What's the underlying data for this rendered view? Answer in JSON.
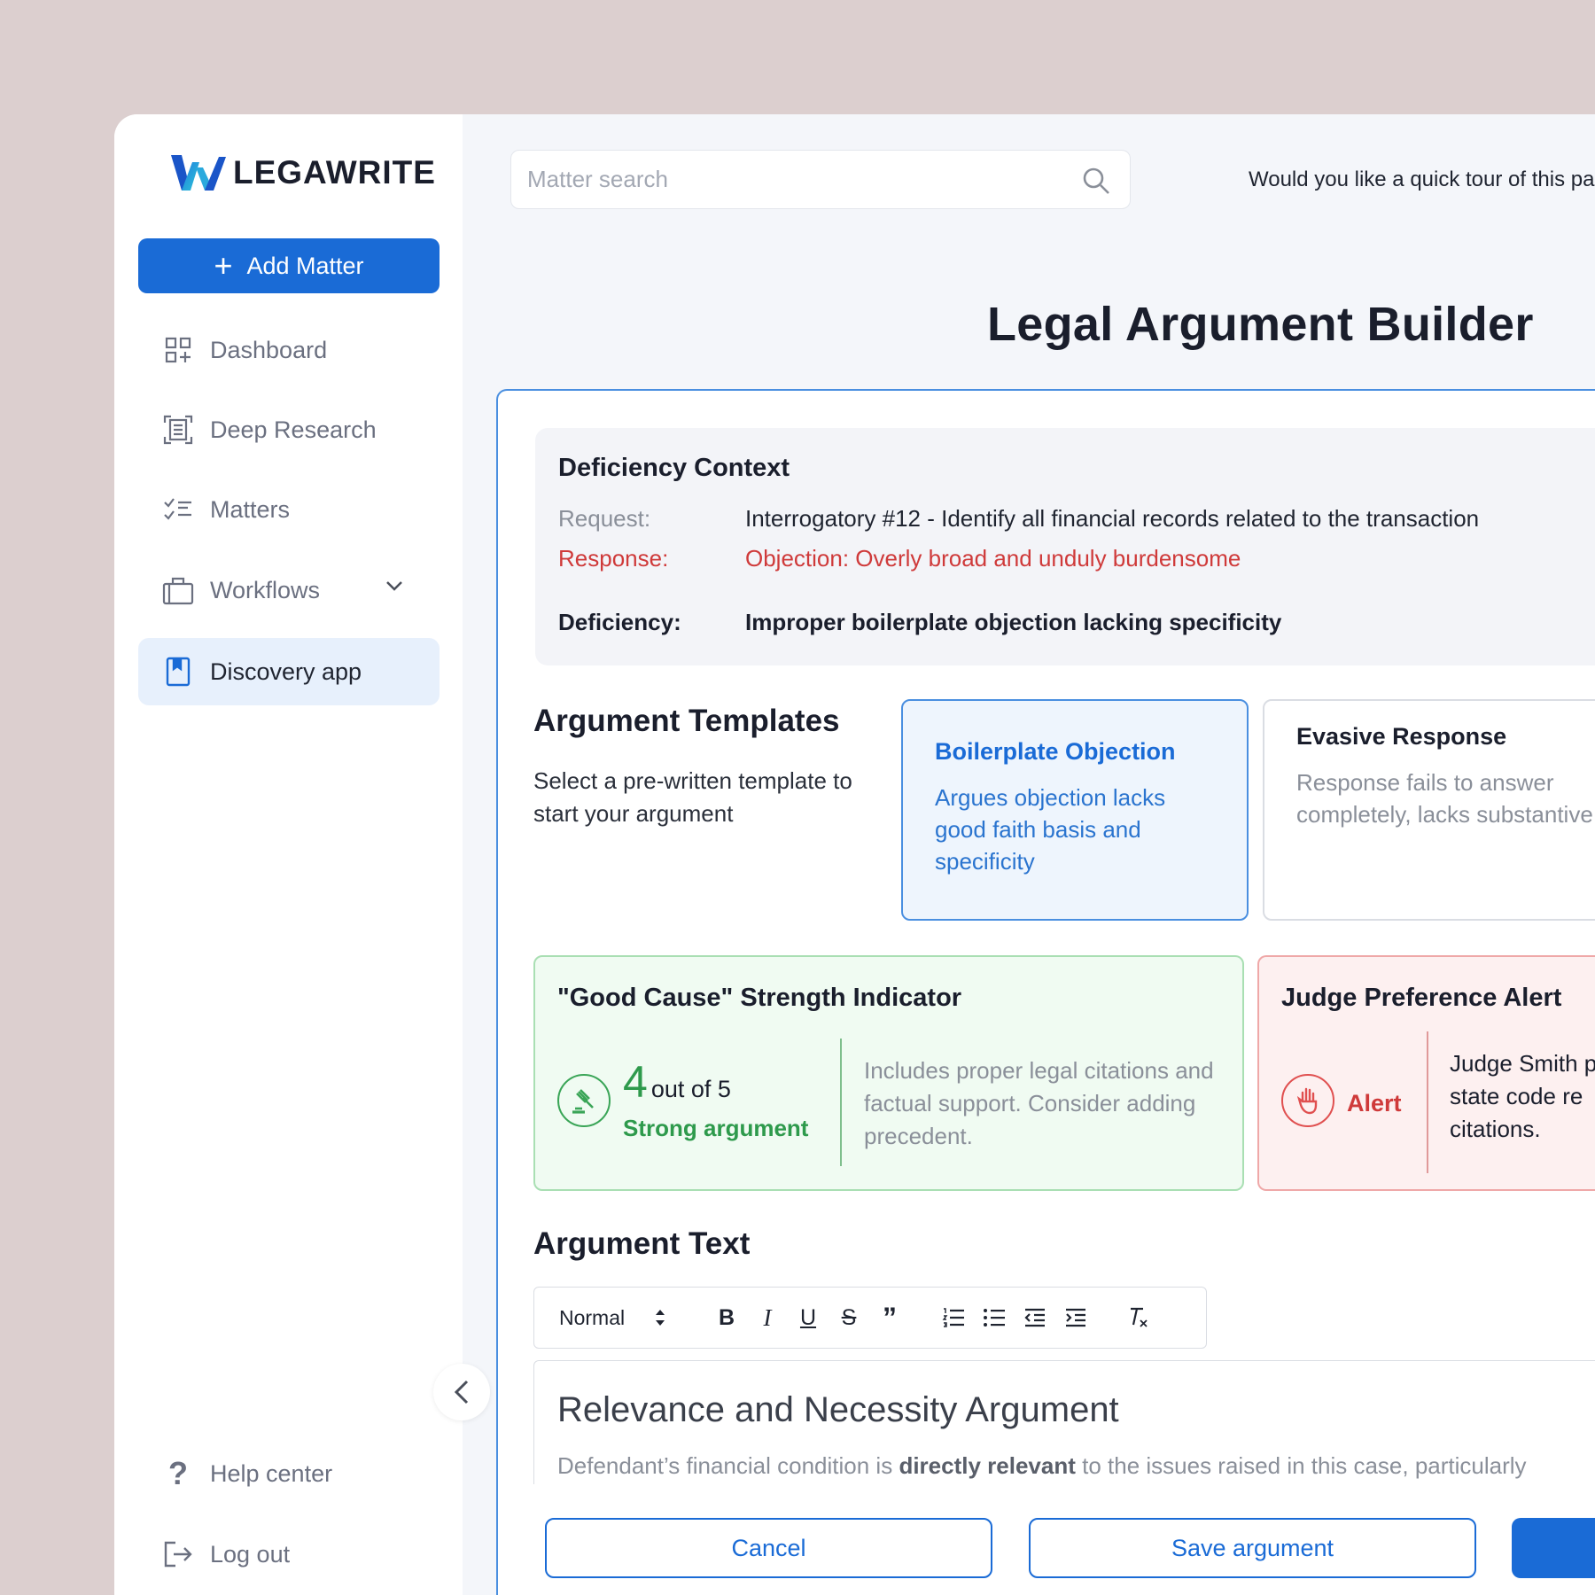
{
  "brand": {
    "name": "LEGAWRITE"
  },
  "sidebar": {
    "add_button": "Add Matter",
    "items": [
      {
        "label": "Dashboard",
        "icon": "dashboard-icon"
      },
      {
        "label": "Deep Research",
        "icon": "document-scan-icon"
      },
      {
        "label": "Matters",
        "icon": "checklist-icon"
      },
      {
        "label": "Workflows",
        "icon": "briefcase-icon",
        "expandable": true
      },
      {
        "label": "Discovery app",
        "icon": "bookmark-book-icon",
        "active": true
      }
    ],
    "footer": [
      {
        "label": "Help center",
        "icon": "question-icon"
      },
      {
        "label": "Log out",
        "icon": "logout-icon"
      }
    ]
  },
  "header": {
    "search_placeholder": "Matter search",
    "tour_prompt": "Would you like a quick tour of this pa"
  },
  "page": {
    "title": "Legal Argument Builder"
  },
  "context": {
    "title": "Deficiency Context",
    "request_label": "Request:",
    "request_value": "Interrogatory #12 - Identify all financial records related to the transaction",
    "response_label": "Response:",
    "response_value": "Objection: Overly broad and unduly burdensome",
    "deficiency_label": "Deficiency:",
    "deficiency_value": "Improper boilerplate objection lacking specificity"
  },
  "templates": {
    "title": "Argument Templates",
    "subtitle": "Select a pre-written template to start your argument",
    "cards": [
      {
        "title": "Boilerplate Objection",
        "desc": "Argues objection lacks good faith basis and specificity",
        "selected": true
      },
      {
        "title": "Evasive Response",
        "desc": "Response fails to answer completely, lacks substantive",
        "selected": false
      }
    ]
  },
  "strength": {
    "title": "\"Good Cause\" Strength Indicator",
    "score": "4",
    "score_suffix": "out of 5",
    "label": "Strong argument",
    "description": "Includes proper legal citations and factual support. Consider adding precedent."
  },
  "judge": {
    "title": "Judge Preference Alert",
    "badge": "Alert",
    "line1": "Judge Smith p",
    "line2": "state code re",
    "line3": "citations."
  },
  "argument": {
    "title": "Argument Text",
    "format_select": "Normal",
    "heading": "Relevance and Necessity Argument",
    "body_pre": "Defendant’s financial condition is ",
    "body_bold": "directly relevant",
    "body_post": " to the issues raised in this case, particularly"
  },
  "actions": {
    "cancel": "Cancel",
    "save": "Save argument"
  },
  "colors": {
    "primary": "#1a6bd6",
    "success": "#2e9a4c",
    "danger": "#cf3a3a",
    "background": "#dccfcf"
  }
}
